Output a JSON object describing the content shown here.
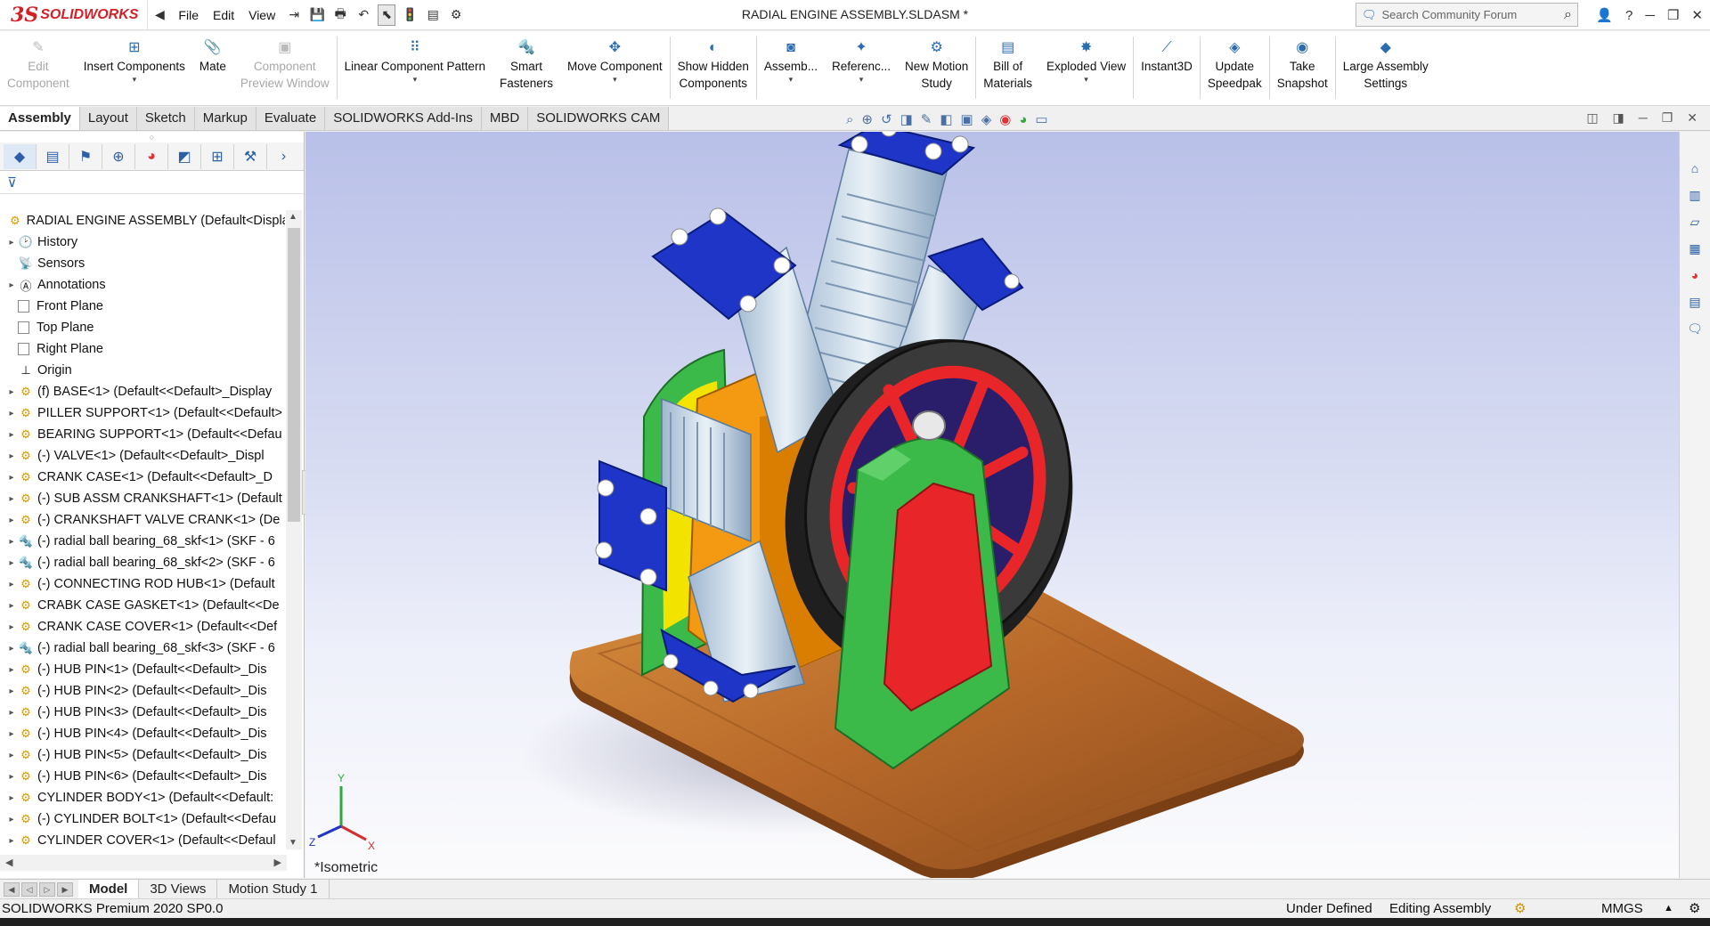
{
  "app": {
    "logo_ds": "3S",
    "logo_text": "SOLIDWORKS",
    "document_title": "RADIAL ENGINE ASSEMBLY.SLDASM *"
  },
  "menu": [
    "File",
    "Edit",
    "View"
  ],
  "search": {
    "placeholder": "Search Community Forum"
  },
  "commands": [
    {
      "label": "Edit\nComponent",
      "icon": "edit-component-icon",
      "disabled": true
    },
    {
      "label": "Insert Components",
      "icon": "insert-components-icon",
      "disabled": false
    },
    {
      "label": "Mate",
      "icon": "mate-icon",
      "disabled": false
    },
    {
      "label": "Component\nPreview Window",
      "icon": "component-preview-icon",
      "disabled": true
    },
    {
      "label": "Linear Component Pattern",
      "icon": "linear-pattern-icon",
      "disabled": false
    },
    {
      "label": "Smart\nFasteners",
      "icon": "smart-fasteners-icon",
      "disabled": false
    },
    {
      "label": "Move Component",
      "icon": "move-component-icon",
      "disabled": false
    },
    {
      "label": "Show Hidden\nComponents",
      "icon": "show-hidden-icon",
      "disabled": false
    },
    {
      "label": "Assemb...",
      "icon": "assembly-features-icon",
      "disabled": false
    },
    {
      "label": "Referenc...",
      "icon": "reference-geometry-icon",
      "disabled": false
    },
    {
      "label": "New Motion\nStudy",
      "icon": "motion-study-icon",
      "disabled": false
    },
    {
      "label": "Bill of\nMaterials",
      "icon": "bill-of-materials-icon",
      "disabled": false
    },
    {
      "label": "Exploded View",
      "icon": "exploded-view-icon",
      "disabled": false
    },
    {
      "label": "Instant3D",
      "icon": "instant3d-icon",
      "disabled": false
    },
    {
      "label": "Update\nSpeedpak",
      "icon": "speedpak-icon",
      "disabled": false
    },
    {
      "label": "Take\nSnapshot",
      "icon": "snapshot-icon",
      "disabled": false
    },
    {
      "label": "Large Assembly\nSettings",
      "icon": "large-assembly-icon",
      "disabled": false
    }
  ],
  "tabs": [
    "Assembly",
    "Layout",
    "Sketch",
    "Markup",
    "Evaluate",
    "SOLIDWORKS Add-Ins",
    "MBD",
    "SOLIDWORKS CAM"
  ],
  "tree": [
    {
      "label": "RADIAL ENGINE ASSEMBLY  (Default<Displa",
      "type": "root",
      "expand": false
    },
    {
      "label": "History",
      "type": "history",
      "expand": true
    },
    {
      "label": "Sensors",
      "type": "sensors",
      "expand": false
    },
    {
      "label": "Annotations",
      "type": "annotations",
      "expand": true
    },
    {
      "label": "Front Plane",
      "type": "plane",
      "expand": false
    },
    {
      "label": "Top Plane",
      "type": "plane",
      "expand": false
    },
    {
      "label": "Right Plane",
      "type": "plane",
      "expand": false
    },
    {
      "label": "Origin",
      "type": "origin",
      "expand": false
    },
    {
      "label": "(f) BASE<1> (Default<<Default>_Display",
      "type": "part",
      "expand": true
    },
    {
      "label": "PILLER SUPPORT<1> (Default<<Default>",
      "type": "part",
      "expand": true
    },
    {
      "label": "BEARING SUPPORT<1> (Default<<Defau",
      "type": "part",
      "expand": true
    },
    {
      "label": "(-) VALVE<1> (Default<<Default>_Displ",
      "type": "part",
      "expand": true
    },
    {
      "label": "CRANK CASE<1> (Default<<Default>_D",
      "type": "part",
      "expand": true
    },
    {
      "label": "(-) SUB ASSM CRANKSHAFT<1> (Default",
      "type": "sub",
      "expand": true
    },
    {
      "label": "(-) CRANKSHAFT VALVE CRANK<1> (De",
      "type": "part",
      "expand": true
    },
    {
      "label": "(-) radial ball bearing_68_skf<1> (SKF - 6",
      "type": "bearing",
      "expand": true
    },
    {
      "label": "(-) radial ball bearing_68_skf<2> (SKF - 6",
      "type": "bearing",
      "expand": true
    },
    {
      "label": "(-) CONNECTING ROD HUB<1> (Default",
      "type": "part",
      "expand": true
    },
    {
      "label": "CRABK CASE GASKET<1> (Default<<De",
      "type": "part",
      "expand": true
    },
    {
      "label": "CRANK CASE COVER<1> (Default<<Def",
      "type": "part",
      "expand": true
    },
    {
      "label": "(-) radial ball bearing_68_skf<3> (SKF - 6",
      "type": "bearing",
      "expand": true
    },
    {
      "label": "(-) HUB PIN<1> (Default<<Default>_Dis",
      "type": "part",
      "expand": true
    },
    {
      "label": "(-) HUB PIN<2> (Default<<Default>_Dis",
      "type": "part",
      "expand": true
    },
    {
      "label": "(-) HUB PIN<3> (Default<<Default>_Dis",
      "type": "part",
      "expand": true
    },
    {
      "label": "(-) HUB PIN<4> (Default<<Default>_Dis",
      "type": "part",
      "expand": true
    },
    {
      "label": "(-) HUB PIN<5> (Default<<Default>_Dis",
      "type": "part",
      "expand": true
    },
    {
      "label": "(-) HUB PIN<6> (Default<<Default>_Dis",
      "type": "part",
      "expand": true
    },
    {
      "label": "CYLINDER BODY<1> (Default<<Default:",
      "type": "part",
      "expand": true
    },
    {
      "label": "(-) CYLINDER BOLT<1> (Default<<Defau",
      "type": "part",
      "expand": true
    },
    {
      "label": "CYLINDER COVER<1> (Default<<Defaul",
      "type": "part",
      "expand": true
    }
  ],
  "viewport": {
    "view_orientation": "*Isometric"
  },
  "bottom_tabs": [
    "Model",
    "3D Views",
    "Motion Study 1"
  ],
  "status": {
    "product": "SOLIDWORKS Premium 2020 SP0.0",
    "state": "Under Defined",
    "mode": "Editing Assembly",
    "units": "MMGS",
    "units_caret": "▲"
  },
  "colors": {
    "brand": "#d41f26",
    "cylinder_cover": "#1f35c8",
    "crank_case": "#f39a12",
    "support": "#3cba49",
    "flywheel_spokes": "#e8262a",
    "flywheel_rim": "#2b2b2b",
    "base_wood": "#b8692a"
  }
}
